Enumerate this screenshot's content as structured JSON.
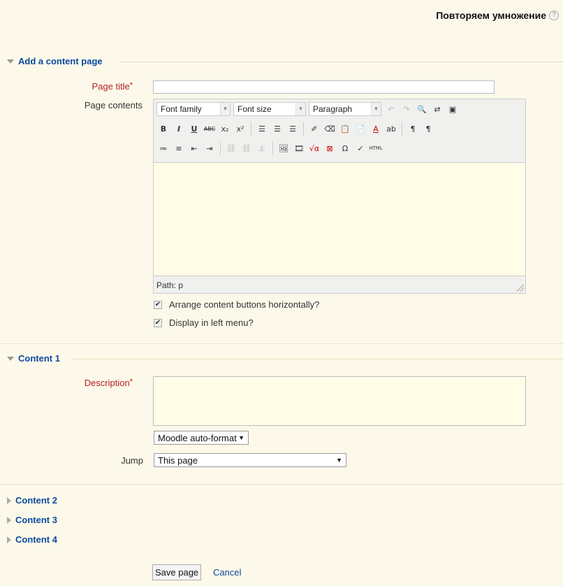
{
  "header": {
    "title": "Повторяем умножение",
    "help_icon": "help-icon"
  },
  "sections": {
    "add_page": "Add a content page",
    "content1": "Content 1",
    "content2": "Content 2",
    "content3": "Content 3",
    "content4": "Content 4"
  },
  "form": {
    "page_title_label": "Page title",
    "page_title_value": "",
    "page_contents_label": "Page contents",
    "editor": {
      "font_family": "Font family",
      "font_size": "Font size",
      "paragraph": "Paragraph",
      "path": "Path: p"
    },
    "checkbox_horizontal": "Arrange content buttons horizontally?",
    "checkbox_horizontal_checked": true,
    "checkbox_menu": "Display in left menu?",
    "checkbox_menu_checked": true,
    "description_label": "Description",
    "format_select": "Moodle auto-format",
    "jump_label": "Jump",
    "jump_select": "This page",
    "required_marker": "*",
    "save_button": "Save page",
    "cancel_link": "Cancel"
  },
  "colors": {
    "background": "#fdf9ea",
    "link": "#0b4aa0",
    "required": "#b22222"
  }
}
